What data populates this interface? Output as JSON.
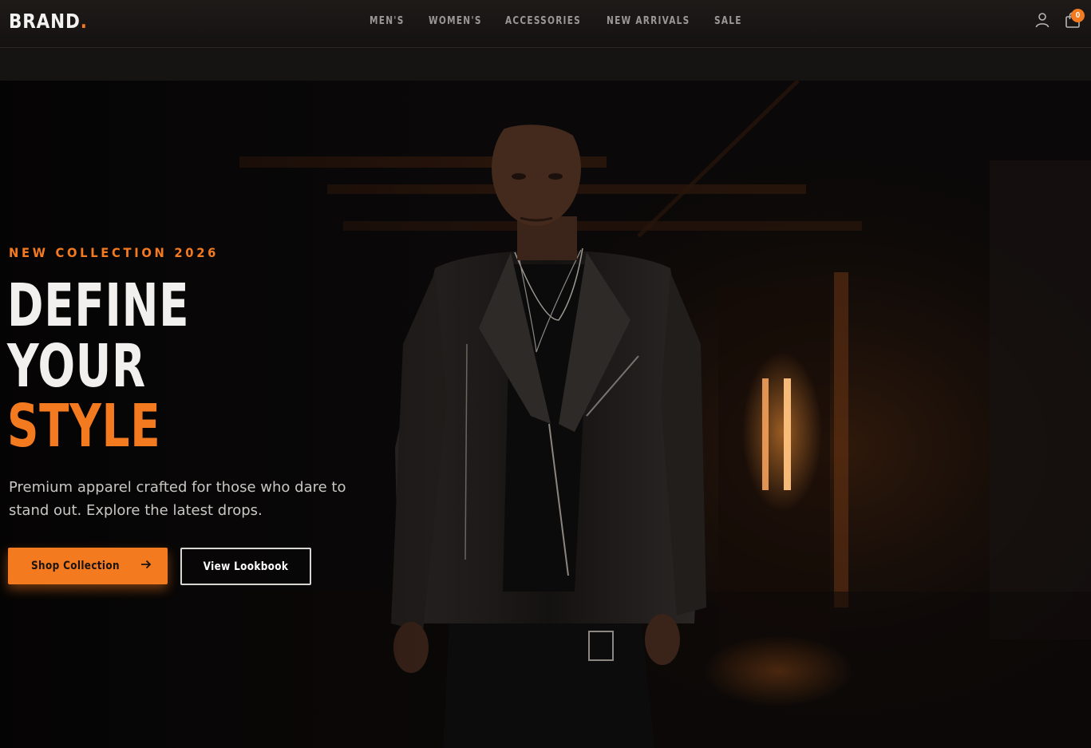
{
  "brand": {
    "name": "BRAND",
    "dot": "."
  },
  "nav": {
    "items": [
      {
        "label": "MEN'S"
      },
      {
        "label": "WOMEN'S"
      },
      {
        "label": "ACCESSORIES"
      },
      {
        "label": "NEW ARRIVALS"
      },
      {
        "label": "SALE"
      }
    ]
  },
  "header_icons": {
    "account_icon": "user-icon",
    "cart_icon": "shopping-bag-icon",
    "cart_count": "0"
  },
  "hero": {
    "eyebrow": "NEW COLLECTION 2026",
    "headline": [
      "DEFINE",
      "YOUR",
      "STYLE"
    ],
    "tagline": "Premium apparel crafted for those who dare to stand out. Explore the latest drops.",
    "primary_cta": {
      "label": "Shop Collection",
      "icon": "arrow-right-icon"
    },
    "secondary_cta": {
      "label": "View Lookbook"
    }
  },
  "colors": {
    "accent": "#f47a20",
    "background": "#0b0a0a",
    "header": "#1a1716",
    "text": "#f1f0ee"
  }
}
